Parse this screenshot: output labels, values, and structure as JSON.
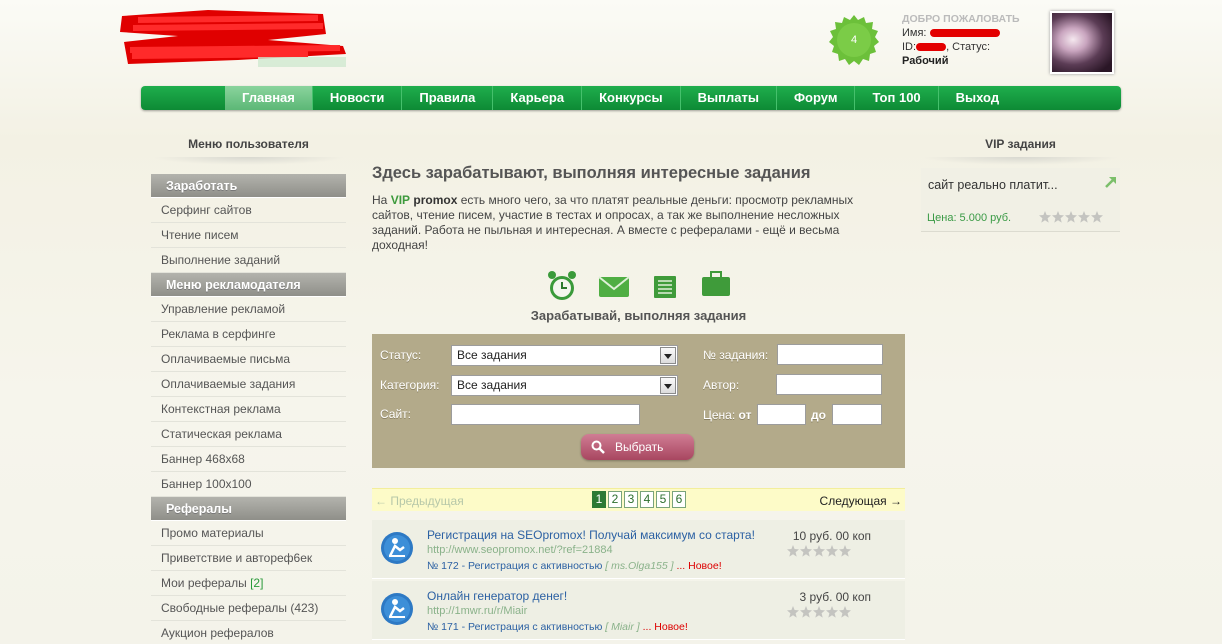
{
  "header": {
    "rating_badge": "4",
    "welcome_title": "ДОБРО ПОЖАЛОВАТЬ",
    "name_label": "Имя:",
    "id_label": "ID:",
    "status_label": ", Статус:",
    "status_value": "Рабочий"
  },
  "nav": {
    "items": [
      "Главная",
      "Новости",
      "Правила",
      "Карьера",
      "Конкурсы",
      "Выплаты",
      "Форум",
      "Топ 100",
      "Выход"
    ],
    "active_index": 0
  },
  "left": {
    "heading": "Меню пользователя",
    "sections": [
      {
        "title": "Заработать",
        "items": [
          "Серфинг сайтов",
          "Чтение писем",
          "Выполнение заданий"
        ]
      },
      {
        "title": "Меню рекламодателя",
        "items": [
          "Управление рекламой",
          "Реклама в серфинге",
          "Оплачиваемые письма",
          "Оплачиваемые задания",
          "Контекстная реклама",
          "Статическая реклама",
          "Баннер 468x68",
          "Баннер 100x100"
        ]
      },
      {
        "title": "Рефералы",
        "items": [
          "Промо материалы",
          "Приветствие и автореф6ек",
          "Мои рефералы",
          "Свободные рефералы (423)",
          "Аукцион рефералов"
        ]
      }
    ],
    "my_referrals_count": "[2]"
  },
  "main": {
    "title": "Здесь зарабатывают, выполняя интересные задания",
    "intro_prefix": "На ",
    "intro_vip": "VIP",
    "intro_promox": "promox",
    "intro_rest": " есть много чего, за что платят реальные деньги: просмотр рекламных сайтов, чтение писем, участие в тестах и опросах, а так же выполнение несложных заданий. Работа не пыльная и интересная. А вместе с рефералами - ещё и весьма доходная!",
    "subtitle": "Зарабатывай, выполняя задания",
    "icons": [
      "alarm-clock-icon",
      "envelope-icon",
      "document-list-icon",
      "briefcase-icon"
    ]
  },
  "filter": {
    "status_label": "Статус:",
    "status_value": "Все задания",
    "category_label": "Категория:",
    "category_value": "Все задания",
    "site_label": "Сайт:",
    "site_value": "",
    "task_no_label": "№ задания:",
    "task_no_value": "",
    "author_label": "Автор:",
    "author_value": "",
    "price_label": "Цена:",
    "from_label": "от",
    "price_from_value": "",
    "to_label": "до",
    "price_to_value": "",
    "submit_label": "Выбрать"
  },
  "pager": {
    "prev_label": "← Предыдущая",
    "next_label": "Следующая →",
    "pages": [
      "1",
      "2",
      "3",
      "4",
      "5",
      "6"
    ],
    "active_page": "1"
  },
  "tasks": [
    {
      "title": "Регистрация на SEOpromox! Получай максимум со старта!",
      "url": "http://www.seopromox.net/?ref=21884",
      "meta": "№ 172 - Регистрация с активностью",
      "author": "[ ms.Olga155 ]",
      "new_label": "... Новое!",
      "price": "10 руб. 00 коп",
      "rating": 0
    },
    {
      "title": "Онлайн генератор денег!",
      "url": "http://1mwr.ru/r/Miair",
      "meta": "№ 171 - Регистрация с активностью",
      "author": "[ Miair ]",
      "new_label": "... Новое!",
      "price": "3 руб. 00 коп",
      "rating": 0
    }
  ],
  "right": {
    "heading": "VIP задания",
    "vip_task": "сайт реально платит...",
    "vip_price": "Цена: 5.000 руб.",
    "vip_rating": 0
  },
  "colors": {
    "nav_green": "#0d8a35",
    "filter_bg": "#b3aa8a",
    "button": "#a84660",
    "link": "#2c61a3"
  }
}
